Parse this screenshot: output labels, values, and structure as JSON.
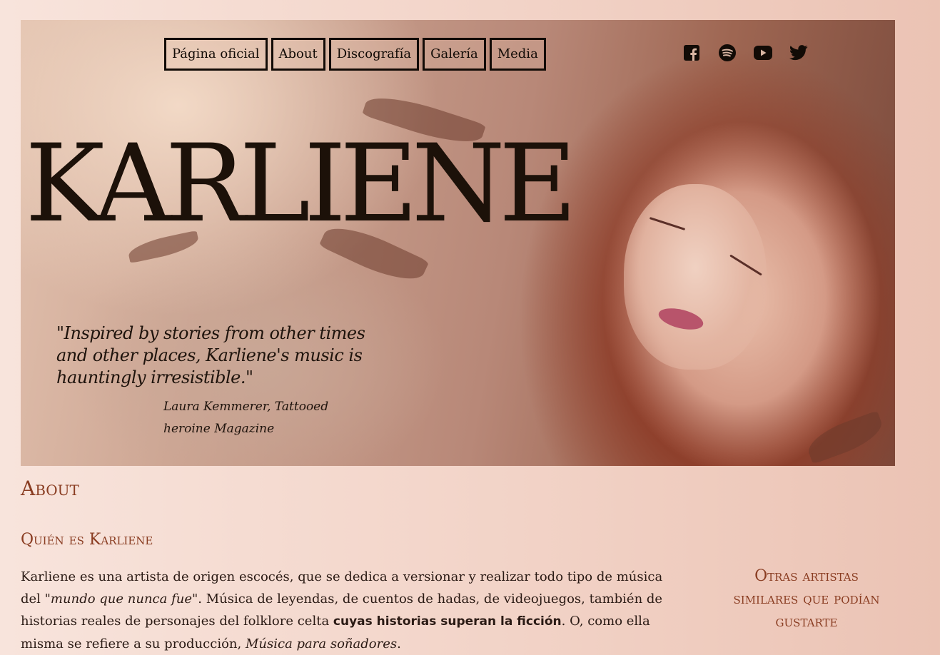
{
  "nav": {
    "items": [
      {
        "label": "Página oficial",
        "id": "pagina-oficial"
      },
      {
        "label": "About",
        "id": "about"
      },
      {
        "label": "Discografía",
        "id": "discografia"
      },
      {
        "label": "Galería",
        "id": "galeria"
      },
      {
        "label": "Media",
        "id": "media"
      }
    ]
  },
  "social": [
    {
      "icon": "facebook-icon"
    },
    {
      "icon": "spotify-icon"
    },
    {
      "icon": "youtube-icon"
    },
    {
      "icon": "twitter-icon"
    }
  ],
  "hero": {
    "title": "KARLIENE",
    "quote": "\"Inspired by stories from other times and other places, Karliene's music is hauntingly irresistible.\"",
    "attribution": "Laura Kemmerer, Tattooed heroine Magazine"
  },
  "about": {
    "heading": "About",
    "subheading": "Quién es Karliene",
    "p1_a": "Karliene es una artista de origen escocés, que se dedica a versionar y realizar todo tipo de música del ",
    "p1_em": "\"mundo que nunca fue\"",
    "p1_b": ". Música de leyendas, de cuentos de hadas, de videojuegos, también de historias reales de personajes del folklore celta ",
    "p1_strong": "cuyas historias superan la ficción",
    "p1_c": ". O, como ella misma se refiere a su producción, ",
    "p1_em2": "Música para soñadores",
    "p1_d": "."
  },
  "sidebar": {
    "heading": "Otras artistas similares que podían gustarte"
  },
  "colors": {
    "accent": "#8a3d22",
    "text": "#2a1a14",
    "nav_border": "#120b06"
  }
}
